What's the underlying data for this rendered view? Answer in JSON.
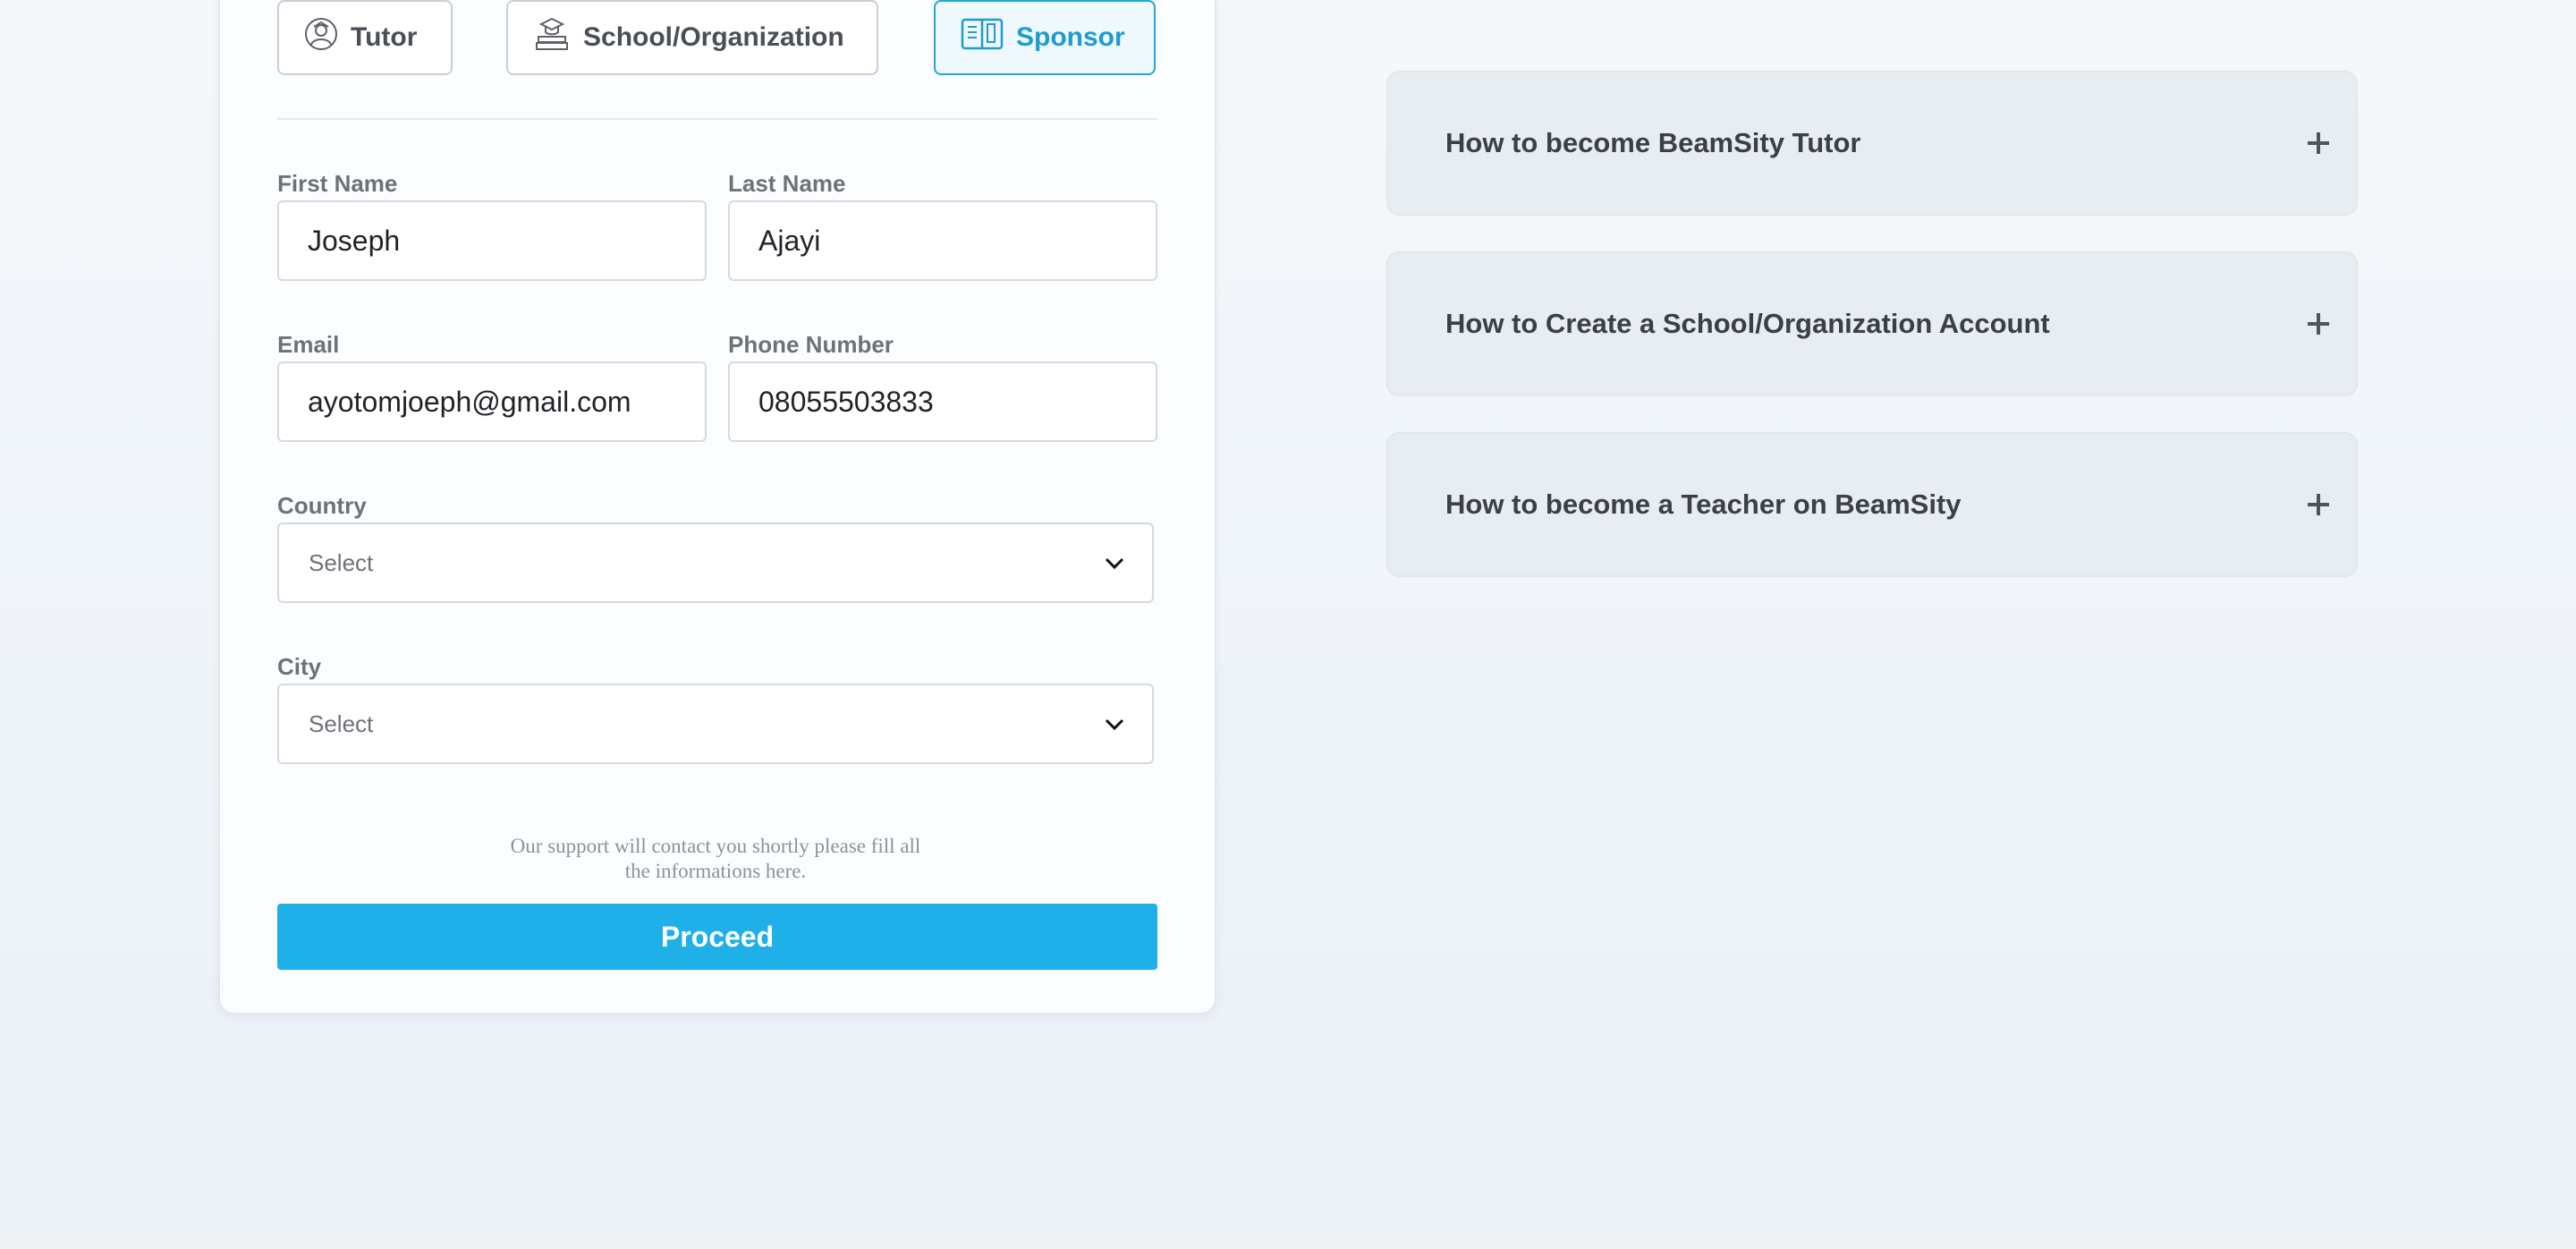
{
  "roles": [
    {
      "label": "Tutor",
      "icon": "tutor-avatar-icon",
      "active": false
    },
    {
      "label": "School/Organization",
      "icon": "school-books-icon",
      "active": false
    },
    {
      "label": "Sponsor",
      "icon": "sponsor-book-icon",
      "active": true
    }
  ],
  "form": {
    "first_name": {
      "label": "First Name",
      "value": "Joseph"
    },
    "last_name": {
      "label": "Last Name",
      "value": "Ajayi"
    },
    "email": {
      "label": "Email",
      "value": "ayotomjoeph@gmail.com"
    },
    "phone": {
      "label": "Phone Number",
      "value": "08055503833"
    },
    "country": {
      "label": "Country",
      "value": "Select"
    },
    "city": {
      "label": "City",
      "value": "Select"
    },
    "support_line1": "Our support will contact you shortly please fill all",
    "support_line2": "the informations here.",
    "proceed_label": "Proceed"
  },
  "faq": [
    {
      "title": "How to become BeamSity Tutor"
    },
    {
      "title": "How to Create a School/Organization Account"
    },
    {
      "title": "How to become a Teacher on BeamSity"
    }
  ],
  "colors": {
    "accent": "#1fb0ea",
    "active_role_text": "#1e9ccf",
    "faq_background": "#e8edf1"
  }
}
